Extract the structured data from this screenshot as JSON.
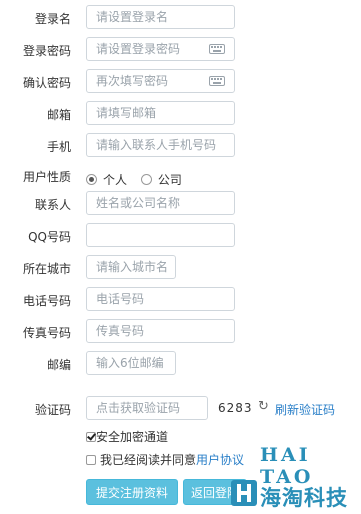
{
  "form": {
    "username": {
      "label": "登录名",
      "placeholder": "请设置登录名"
    },
    "password": {
      "label": "登录密码",
      "placeholder": "请设置登录密码"
    },
    "confirm_password": {
      "label": "确认密码",
      "placeholder": "再次填写密码"
    },
    "email": {
      "label": "邮箱",
      "placeholder": "请填写邮箱"
    },
    "mobile": {
      "label": "手机",
      "placeholder": "请输入联系人手机号码"
    },
    "user_type": {
      "label": "用户性质",
      "options": [
        "个人",
        "公司"
      ],
      "selected": "个人"
    },
    "contact": {
      "label": "联系人",
      "placeholder": "姓名或公司名称"
    },
    "qq": {
      "label": "QQ号码",
      "placeholder": ""
    },
    "city": {
      "label": "所在城市",
      "placeholder": "请输入城市名"
    },
    "phone": {
      "label": "电话号码",
      "placeholder": "电话号码"
    },
    "fax": {
      "label": "传真号码",
      "placeholder": "传真号码"
    },
    "postcode": {
      "label": "邮编",
      "placeholder": "输入6位邮编"
    },
    "captcha": {
      "label": "验证码",
      "placeholder": "点击获取验证码",
      "code": "6283",
      "refresh_label": "刷新验证码"
    },
    "secure_channel": {
      "label": "安全加密通道",
      "checked": true
    },
    "agreement": {
      "prefix": "我已经阅读并同意",
      "link": "用户协议",
      "checked": false
    }
  },
  "buttons": {
    "submit": "提交注册资料",
    "back": "返回登陆"
  },
  "watermark": {
    "latin": "HAI TAO",
    "chinese": "海淘科技"
  },
  "colors": {
    "accent_button": "#5bc0de",
    "link": "#2a7fc8",
    "logo": "#2a8fb8"
  }
}
